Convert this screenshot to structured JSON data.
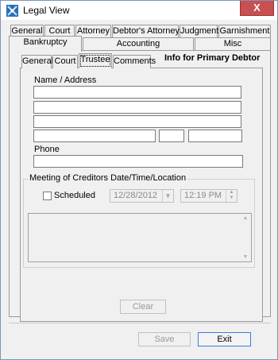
{
  "window": {
    "title": "Legal View",
    "close_label": "X"
  },
  "outer_tabs_row1": [
    {
      "label": "General"
    },
    {
      "label": "Court"
    },
    {
      "label": "Attorney"
    },
    {
      "label": "Debtor's Attorney"
    },
    {
      "label": "Judgment"
    },
    {
      "label": "Garnishment"
    }
  ],
  "outer_tabs_row2": [
    {
      "label": "Bankruptcy",
      "active": true
    },
    {
      "label": "Accounting"
    },
    {
      "label": "Misc"
    }
  ],
  "inner_tabs": [
    {
      "label": "General"
    },
    {
      "label": "Court"
    },
    {
      "label": "Trustee",
      "active": true
    },
    {
      "label": "Comments"
    }
  ],
  "info_label": "Info for Primary Debtor",
  "form": {
    "name_address_label": "Name / Address",
    "phone_label": "Phone",
    "name_value": "",
    "address1_value": "",
    "address2_value": "",
    "city_value": "",
    "state_value": "",
    "zip_value": "",
    "phone_value": ""
  },
  "meeting": {
    "group_title": "Meeting of Creditors  Date/Time/Location",
    "scheduled_label": "Scheduled",
    "scheduled_checked": false,
    "date_value": "12/28/2012",
    "time_value": "12:19 PM",
    "location_value": "",
    "clear_label": "Clear"
  },
  "footer": {
    "save_label": "Save",
    "exit_label": "Exit"
  }
}
